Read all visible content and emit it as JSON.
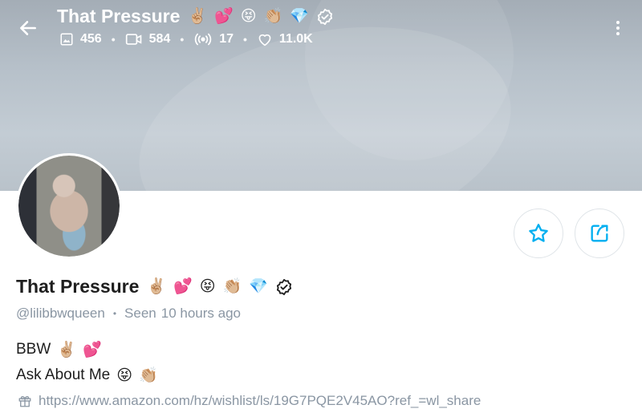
{
  "header": {
    "title": "That Pressure",
    "title_emojis": [
      "✌🏼",
      "💕",
      "😝",
      "👏🏼",
      "💎"
    ],
    "stats": {
      "photos": "456",
      "videos": "584",
      "streams": "17",
      "likes": "11.0K"
    }
  },
  "profile": {
    "name": "That Pressure",
    "name_emojis": [
      "✌🏼",
      "💕",
      "😝",
      "👏🏼",
      "💎"
    ],
    "handle": "@lilibbwqueen",
    "seen_label": "Seen",
    "seen_time": "10 hours ago",
    "bio_line1": "BBW",
    "bio_line1_emojis": [
      "✌🏼",
      "💕"
    ],
    "bio_line2": "Ask About Me",
    "bio_line2_emojis": [
      "😝",
      "👏🏼"
    ],
    "link": "https://www.amazon.com/hz/wishlist/ls/19G7PQE2V45AO?ref_=wl_share"
  },
  "icons": {
    "back": "arrow-left-icon",
    "verified": "verified-badge-icon",
    "photos": "image-icon",
    "videos": "video-icon",
    "streams": "broadcast-icon",
    "likes": "heart-icon",
    "more": "more-vertical-icon",
    "star": "star-icon",
    "share": "share-icon",
    "link": "gift-icon"
  },
  "colors": {
    "accent": "#00aff0",
    "muted": "#8a96a3",
    "text": "#1e1e1e"
  }
}
